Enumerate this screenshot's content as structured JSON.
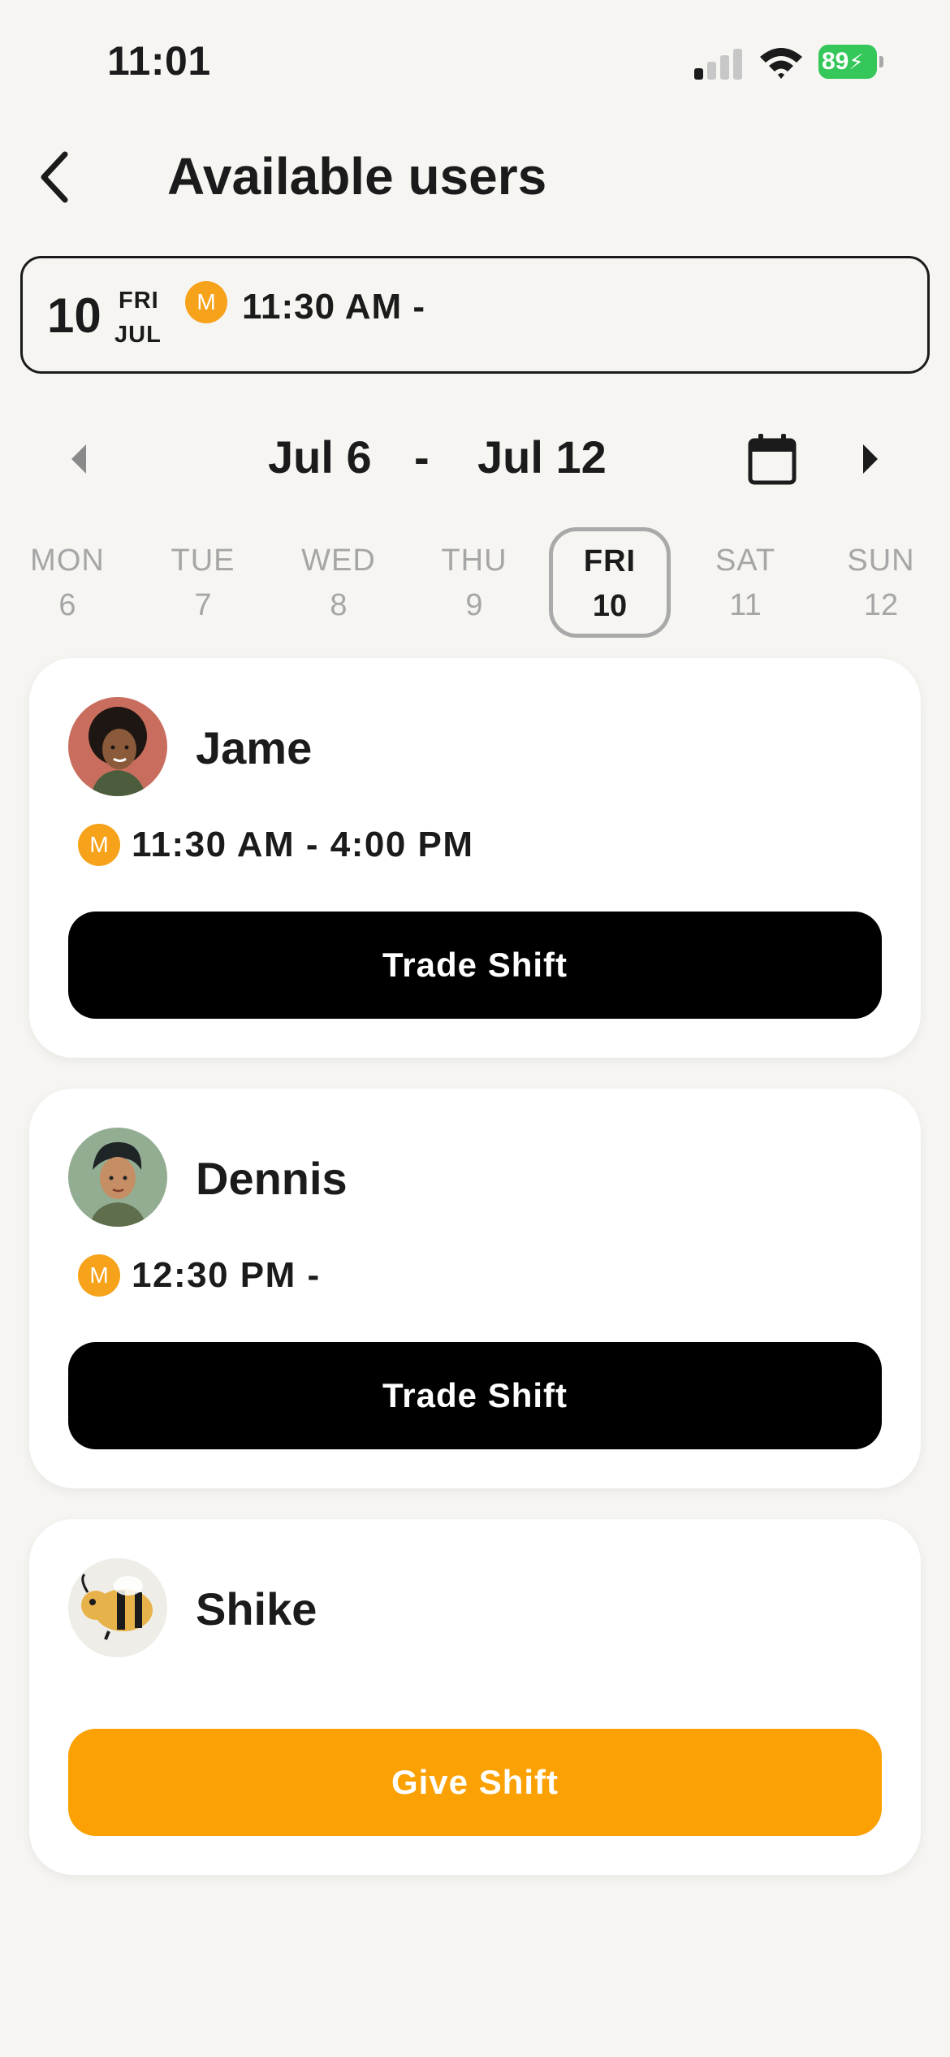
{
  "status_bar": {
    "time": "11:01",
    "battery": "89"
  },
  "header": {
    "title": "Available users"
  },
  "selected_shift": {
    "day": "10",
    "weekday": "FRI",
    "month": "JUL",
    "badge": "M",
    "time": "11:30 AM -"
  },
  "week": {
    "start": "Jul 6",
    "separator": "-",
    "end": "Jul 12",
    "days": [
      {
        "dow": "MON",
        "num": "6"
      },
      {
        "dow": "TUE",
        "num": "7"
      },
      {
        "dow": "WED",
        "num": "8"
      },
      {
        "dow": "THU",
        "num": "9"
      },
      {
        "dow": "FRI",
        "num": "10"
      },
      {
        "dow": "SAT",
        "num": "11"
      },
      {
        "dow": "SUN",
        "num": "12"
      }
    ],
    "selected_index": 4
  },
  "users": [
    {
      "name": "Jame",
      "badge": "M",
      "shift": "11:30 AM - 4:00 PM",
      "action": "Trade Shift"
    },
    {
      "name": "Dennis",
      "badge": "M",
      "shift": "12:30 PM -",
      "action": "Trade Shift"
    },
    {
      "name": "Shike",
      "action": "Give Shift"
    }
  ],
  "colors": {
    "accent": "#fba104",
    "badge": "#f7a21b",
    "background": "#f6f5f2",
    "battery": "#35c759"
  }
}
